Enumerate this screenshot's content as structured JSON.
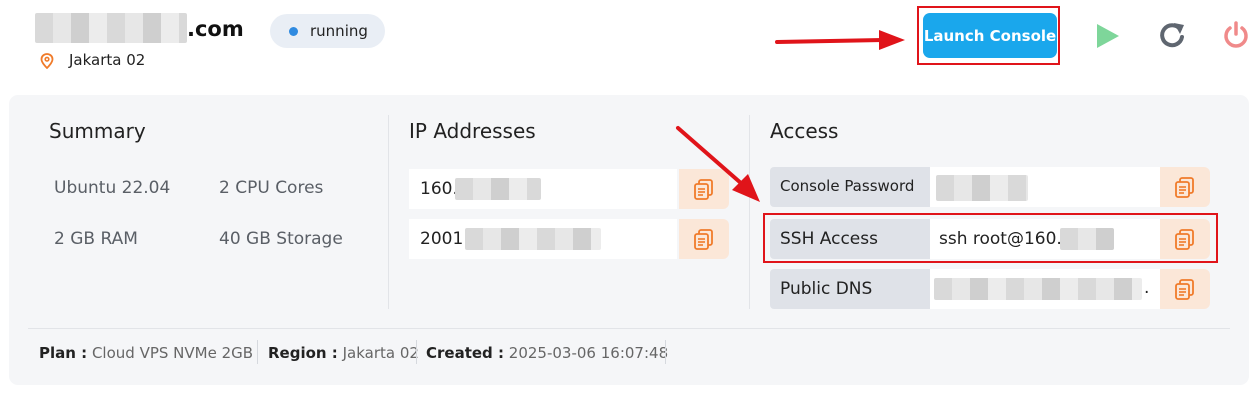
{
  "header": {
    "hostname_suffix": ".com",
    "status": "running",
    "location": "Jakarta 02",
    "launch_label": "Launch Console",
    "colors": {
      "accent": "#1aa7ec",
      "play": "#7ed69a",
      "restart": "#5f6670",
      "power": "#f08a8a",
      "highlight": "#e0141a"
    }
  },
  "summary": {
    "title": "Summary",
    "os": "Ubuntu 22.04",
    "cpu": "2 CPU Cores",
    "ram": "2 GB RAM",
    "storage": "40 GB Storage"
  },
  "ip": {
    "title": "IP Addresses",
    "ipv4_prefix": "160.",
    "ipv6_prefix": "2001:"
  },
  "access": {
    "title": "Access",
    "console_password_label": "Console Password",
    "ssh_label": "SSH Access",
    "ssh_value_prefix": "ssh root@160.",
    "dns_label": "Public DNS",
    "dns_suffix": "."
  },
  "footer": {
    "plan_label": "Plan :",
    "plan_value": "Cloud VPS NVMe 2GB",
    "region_label": "Region :",
    "region_value": "Jakarta 02",
    "created_label": "Created :",
    "created_value": "2025-03-06 16:07:48"
  }
}
